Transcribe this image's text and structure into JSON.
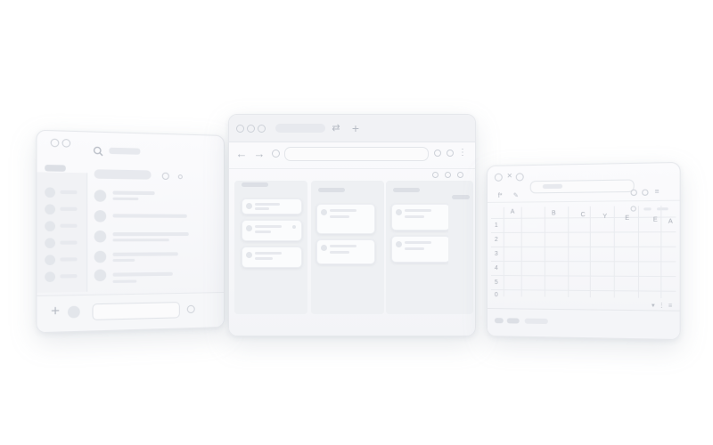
{
  "colors": {
    "background": "#ffffff",
    "window": "#f6f7f9",
    "placeholder": "#e7e9ee",
    "outline": "#cdd1d8"
  },
  "chat_window": {
    "icons": [
      "video-icon",
      "search-icon",
      "plus-icon"
    ],
    "contacts": 6,
    "messages": 5
  },
  "browser_window": {
    "icons": [
      "back-arrow-icon",
      "forward-arrow-icon",
      "reload-icon",
      "new-tab-icon",
      "swap-icon"
    ],
    "columns": 3
  },
  "sheet_window": {
    "columns": [
      "A",
      "B",
      "C",
      "Y",
      "E",
      "E",
      "A"
    ],
    "rows": [
      "1",
      "2",
      "3",
      "4",
      "5",
      "0"
    ],
    "toolbar_label": "f*"
  }
}
